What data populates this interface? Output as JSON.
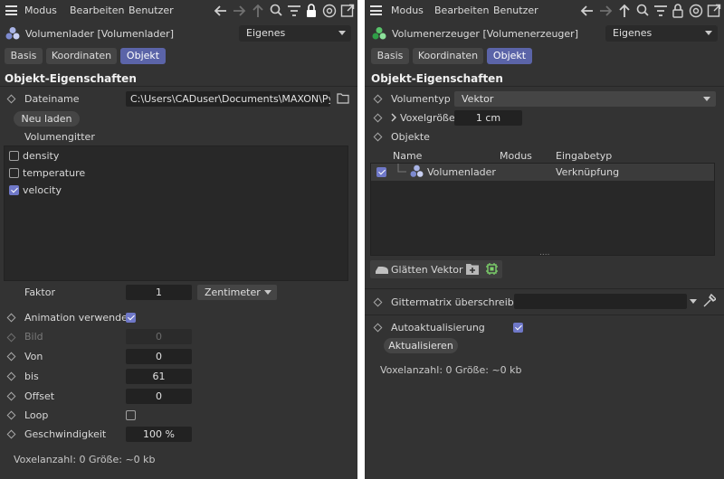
{
  "left": {
    "menu": [
      "Modus",
      "Bearbeiten",
      "Benutzer"
    ],
    "title": "Volumenlader [Volumenlader]",
    "preset": "Eigenes",
    "tabs": [
      "Basis",
      "Koordinaten",
      "Objekt"
    ],
    "active_tab": "Objekt",
    "section_title": "Objekt-Eigenschaften",
    "filename_label": "Dateiname",
    "filename_value": "C:\\Users\\CADuser\\Documents\\MAXON\\Pyro",
    "reload_button": "Neu laden",
    "grid_label": "Volumengitter",
    "grids": [
      {
        "name": "density",
        "checked": false
      },
      {
        "name": "temperature",
        "checked": false
      },
      {
        "name": "velocity",
        "checked": true
      }
    ],
    "factor_label": "Faktor",
    "factor_value": "1",
    "unit": "Zentimeter",
    "anim_label": "Animation verwenden",
    "anim_checked": true,
    "frame_label": "Bild",
    "frame_value": "0",
    "from_label": "Von",
    "from_value": "0",
    "to_label": "bis",
    "to_value": "61",
    "offset_label": "Offset",
    "offset_value": "0",
    "loop_label": "Loop",
    "loop_checked": false,
    "speed_label": "Geschwindigkeit",
    "speed_value": "100 %",
    "footer": "Voxelanzahl: 0   Größe: ~0 kb"
  },
  "right": {
    "menu": [
      "Modus",
      "Bearbeiten",
      "Benutzer"
    ],
    "title": "Volumenerzeuger [Volumenerzeuger]",
    "preset": "Eigenes",
    "tabs": [
      "Basis",
      "Koordinaten",
      "Objekt"
    ],
    "active_tab": "Objekt",
    "section_title": "Objekt-Eigenschaften",
    "voltype_label": "Volumentyp",
    "voltype_value": "Vektor",
    "voxel_label": "Voxelgröße",
    "voxel_value": "1 cm",
    "objects_label": "Objekte",
    "columns": [
      "Name",
      "Modus",
      "Eingabetyp"
    ],
    "rows": [
      {
        "name": "Volumenlader",
        "mode": "",
        "input": "Verknüpfung",
        "checked": true
      }
    ],
    "smooth_button": "Glätten Vektor",
    "matrix_label": "Gittermatrix überschreiben",
    "matrix_value": "",
    "autoupdate_label": "Autoaktualisierung",
    "autoupdate_checked": true,
    "update_button": "Aktualisieren",
    "footer": "Voxelanzahl: 0   Größe: ~0 kb"
  },
  "colors": {
    "panel_bg": "#333333",
    "field_bg": "#222222",
    "accent": "#5b64a8",
    "checkbox_on": "#6f78c8",
    "text": "#d8d8d8"
  },
  "icons": {
    "toolbar": [
      "arrow-left-icon",
      "arrow-right-icon",
      "arrow-up-icon",
      "search-icon",
      "filter-icon",
      "lock-icon",
      "target-icon",
      "new-window-icon"
    ],
    "volume_loader": "volume-loader-icon",
    "volume_builder": "volume-builder-icon"
  }
}
